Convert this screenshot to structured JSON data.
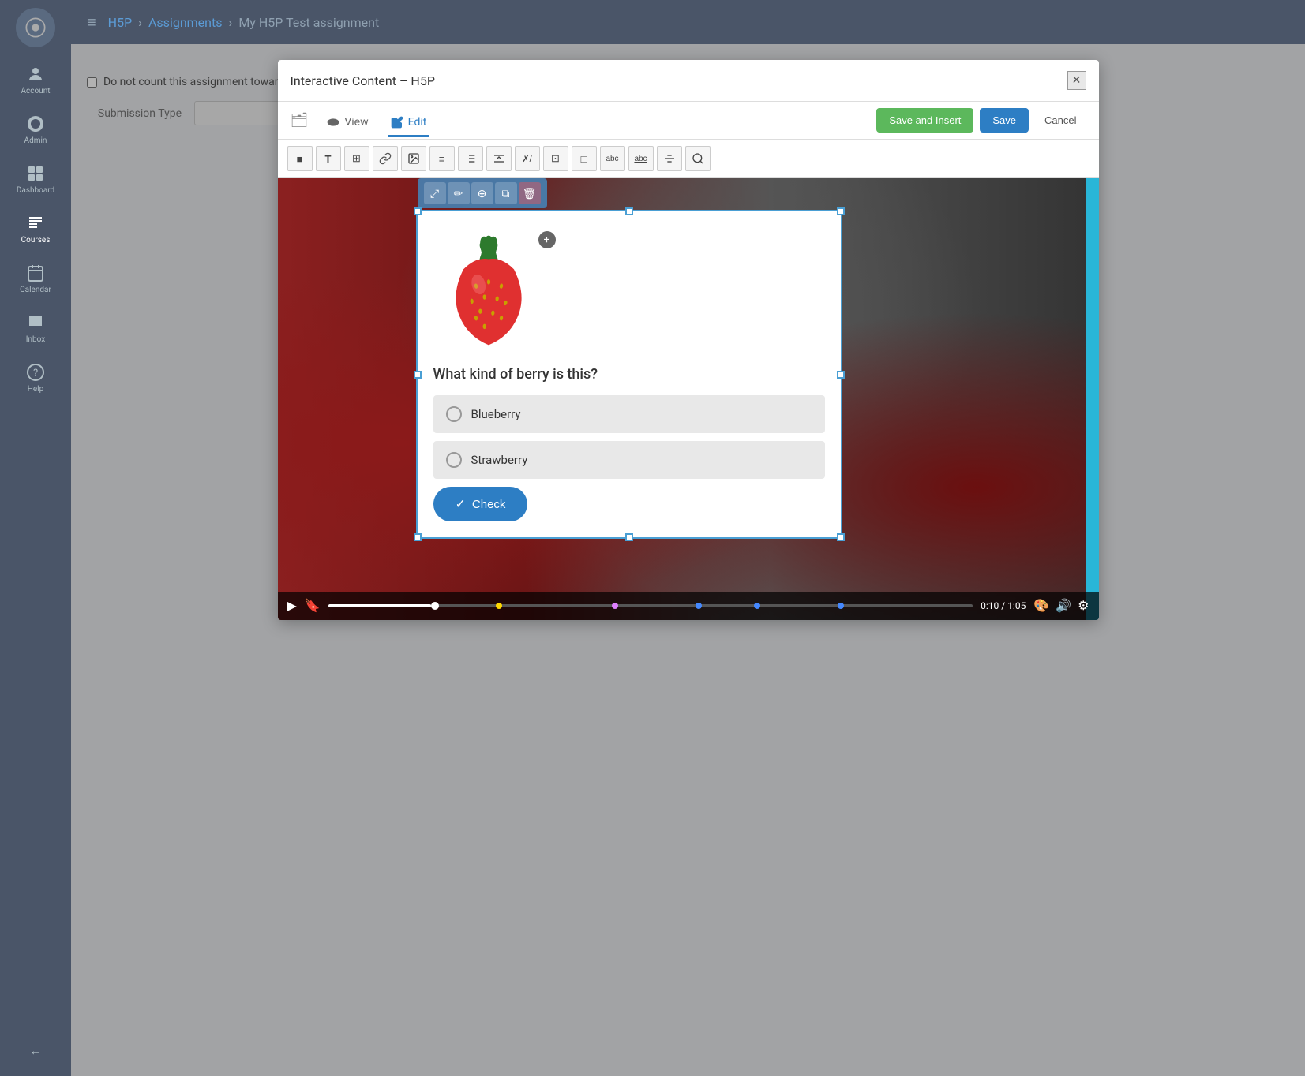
{
  "sidebar": {
    "logo_icon": "☀",
    "items": [
      {
        "id": "account",
        "label": "Account",
        "icon": "👤"
      },
      {
        "id": "admin",
        "label": "Admin",
        "icon": "🔧"
      },
      {
        "id": "dashboard",
        "label": "Dashboard",
        "icon": "📊"
      },
      {
        "id": "courses",
        "label": "Courses",
        "icon": "📚",
        "active": true
      },
      {
        "id": "calendar",
        "label": "Calendar",
        "icon": "📅"
      },
      {
        "id": "inbox",
        "label": "Inbox",
        "icon": "✉"
      },
      {
        "id": "help",
        "label": "Help",
        "icon": "❓"
      }
    ],
    "collapse_icon": "←"
  },
  "topbar": {
    "breadcrumb": [
      {
        "label": "H5P",
        "link": true
      },
      {
        "label": "Assignments",
        "link": true
      },
      {
        "label": "My H5P Test assignment",
        "link": false
      }
    ],
    "menu_icon": "≡"
  },
  "modal": {
    "title": "Interactive Content – H5P",
    "close_icon": "✕",
    "tabs": [
      {
        "id": "view",
        "label": "View",
        "icon": "👁",
        "active": false
      },
      {
        "id": "edit",
        "label": "Edit",
        "icon": "✏",
        "active": true
      }
    ],
    "buttons": {
      "save_insert": "Save and Insert",
      "save": "Save",
      "cancel": "Cancel"
    },
    "toolbar": {
      "buttons": [
        "■",
        "T",
        "⊞",
        "🔗",
        "🖼",
        "≡",
        "⊟",
        "✗/",
        "⊡",
        "□",
        "abc",
        "abc̲",
        "⊕",
        "🔍"
      ]
    },
    "float_actions": [
      "⤢",
      "✏",
      "⊕",
      "⧉",
      "🗑"
    ],
    "quiz": {
      "question": "What kind of berry is this?",
      "options": [
        {
          "id": "blueberry",
          "label": "Blueberry"
        },
        {
          "id": "strawberry",
          "label": "Strawberry"
        }
      ],
      "check_btn": "Check"
    },
    "video": {
      "time_current": "0:10",
      "time_total": "1:05",
      "time_display": "0:10 / 1:05"
    }
  },
  "page": {
    "checkbox_label": "Do not count this assignment towards the final grade",
    "submission_label": "Submission Type"
  }
}
